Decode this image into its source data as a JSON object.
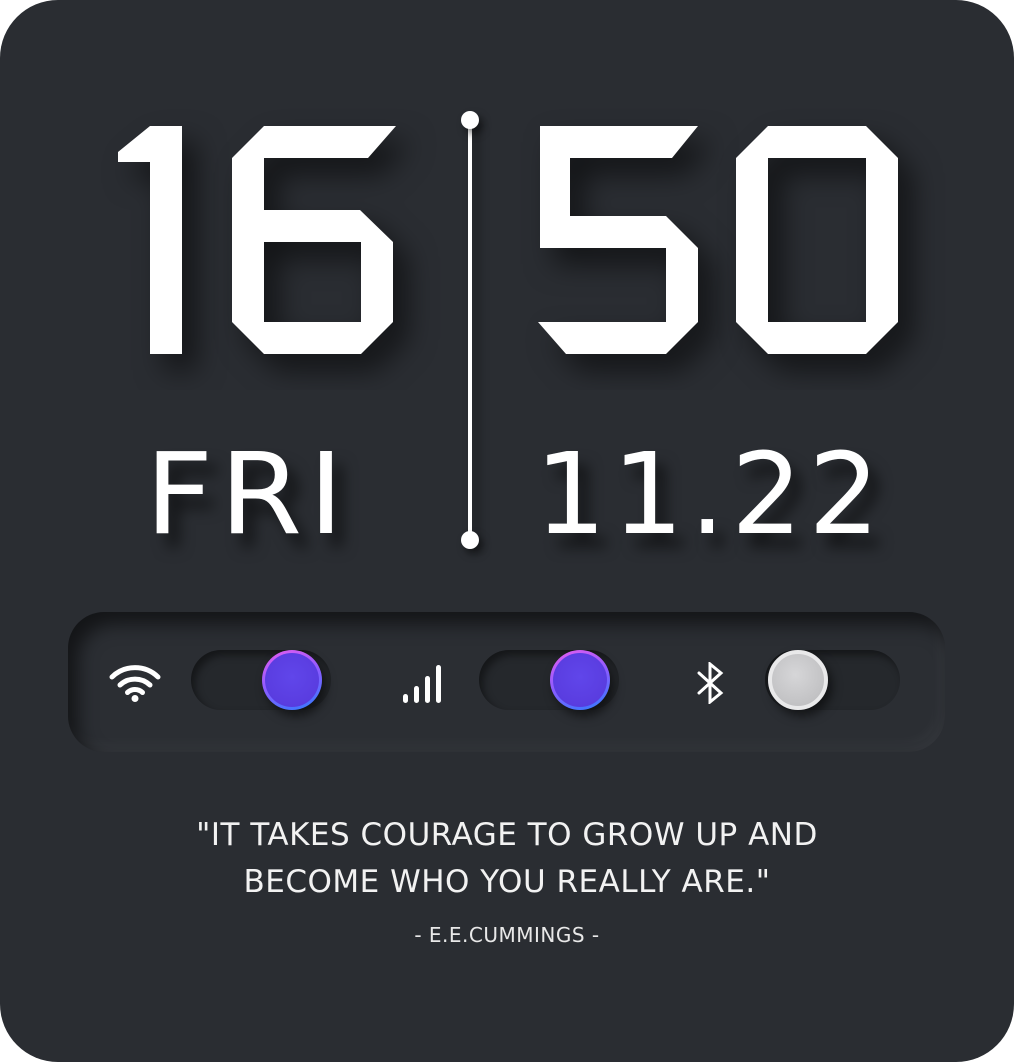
{
  "clock": {
    "hours": "16",
    "minutes": "50",
    "day": "FRI",
    "date": "11.22"
  },
  "toggles": [
    {
      "name": "wifi",
      "icon": "wifi-icon",
      "state": "on"
    },
    {
      "name": "signal",
      "icon": "signal-bars-icon",
      "state": "on"
    },
    {
      "name": "bluetooth",
      "icon": "bluetooth-icon",
      "state": "off"
    }
  ],
  "quote": {
    "line1": "\"IT TAKES COURAGE TO GROW UP AND",
    "line2": "BECOME WHO YOU REALLY ARE.\"",
    "author": "- E.E.CUMMINGS -"
  },
  "colors": {
    "background": "#2a2d32",
    "text": "#ffffff",
    "toggle_on_gradient_start": "#e85cf0",
    "toggle_on_gradient_end": "#2f7cff",
    "toggle_off": "#c9c9cb"
  }
}
